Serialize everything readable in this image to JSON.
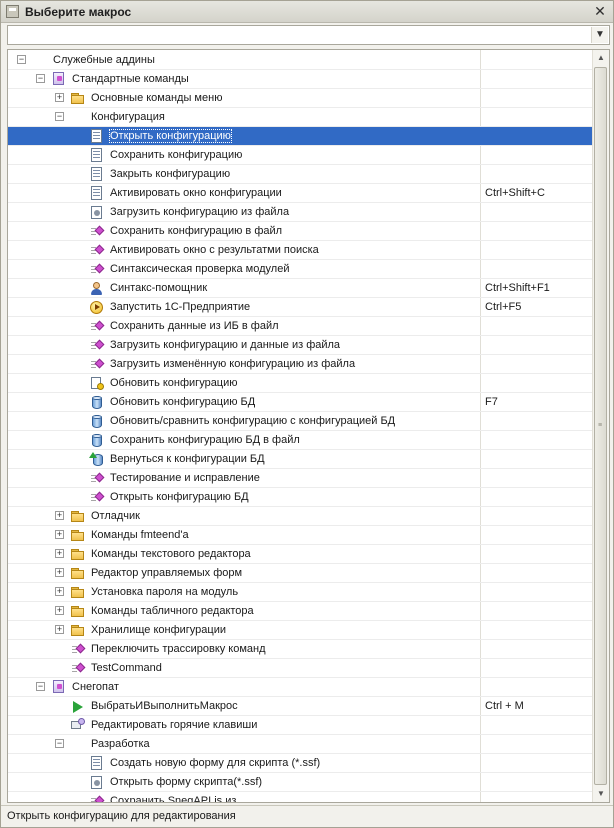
{
  "window": {
    "title": "Выберите макрос",
    "close_label": "✕"
  },
  "filter": {
    "value": "",
    "arrow": "▼"
  },
  "tree": {
    "rows": [
      {
        "level": 0,
        "expander": "−",
        "icon": "folder-open",
        "label": "Служебные аддины",
        "hotkey": ""
      },
      {
        "level": 1,
        "expander": "−",
        "icon": "purple",
        "label": "Стандартные команды",
        "hotkey": ""
      },
      {
        "level": 2,
        "expander": "+",
        "icon": "folder",
        "label": "Основные команды меню",
        "hotkey": ""
      },
      {
        "level": 2,
        "expander": "−",
        "icon": "folder-open",
        "label": "Конфигурация",
        "hotkey": ""
      },
      {
        "level": 3,
        "expander": "",
        "icon": "doc",
        "label": "Открыть конфигурацию",
        "hotkey": "",
        "selected": true
      },
      {
        "level": 3,
        "expander": "",
        "icon": "doc",
        "label": "Сохранить конфигурацию",
        "hotkey": ""
      },
      {
        "level": 3,
        "expander": "",
        "icon": "doc",
        "label": "Закрыть конфигурацию",
        "hotkey": ""
      },
      {
        "level": 3,
        "expander": "",
        "icon": "doc",
        "label": "Активировать окно конфигурации",
        "hotkey": "Ctrl+Shift+C"
      },
      {
        "level": 3,
        "expander": "",
        "icon": "gear",
        "label": "Загрузить конфигурацию из файла",
        "hotkey": ""
      },
      {
        "level": 3,
        "expander": "",
        "icon": "diamond",
        "label": "Сохранить конфигурацию в файл",
        "hotkey": ""
      },
      {
        "level": 3,
        "expander": "",
        "icon": "diamond",
        "label": "Активировать окно с результатми поиска",
        "hotkey": ""
      },
      {
        "level": 3,
        "expander": "",
        "icon": "diamond",
        "label": "Синтаксическая проверка модулей",
        "hotkey": ""
      },
      {
        "level": 3,
        "expander": "",
        "icon": "person",
        "label": "Синтакс-помощник",
        "hotkey": "Ctrl+Shift+F1"
      },
      {
        "level": 3,
        "expander": "",
        "icon": "play",
        "label": "Запустить 1С-Предприятие",
        "hotkey": "Ctrl+F5"
      },
      {
        "level": 3,
        "expander": "",
        "icon": "diamond",
        "label": "Сохранить данные из ИБ в файл",
        "hotkey": ""
      },
      {
        "level": 3,
        "expander": "",
        "icon": "diamond",
        "label": "Загрузить конфигурацию и данные из файла",
        "hotkey": ""
      },
      {
        "level": 3,
        "expander": "",
        "icon": "diamond",
        "label": "Загрузить изменённую конфигурацию из файла",
        "hotkey": ""
      },
      {
        "level": 3,
        "expander": "",
        "icon": "refresh",
        "label": "Обновить конфигурацию",
        "hotkey": ""
      },
      {
        "level": 3,
        "expander": "",
        "icon": "db",
        "label": "Обновить конфигурацию БД",
        "hotkey": "F7"
      },
      {
        "level": 3,
        "expander": "",
        "icon": "db",
        "label": "Обновить/сравнить конфигурацию с конфигурацией БД",
        "hotkey": ""
      },
      {
        "level": 3,
        "expander": "",
        "icon": "db",
        "label": "Сохранить конфигурацию БД в файл",
        "hotkey": ""
      },
      {
        "level": 3,
        "expander": "",
        "icon": "return",
        "label": "Вернуться  к конфигурации БД",
        "hotkey": ""
      },
      {
        "level": 3,
        "expander": "",
        "icon": "diamond",
        "label": "Тестирование и исправление",
        "hotkey": ""
      },
      {
        "level": 3,
        "expander": "",
        "icon": "diamond",
        "label": "Открыть конфигурацию БД",
        "hotkey": ""
      },
      {
        "level": 2,
        "expander": "+",
        "icon": "folder",
        "label": "Отладчик",
        "hotkey": ""
      },
      {
        "level": 2,
        "expander": "+",
        "icon": "folder",
        "label": "Команды fmteend'a",
        "hotkey": ""
      },
      {
        "level": 2,
        "expander": "+",
        "icon": "folder",
        "label": "Команды текстового редактора",
        "hotkey": ""
      },
      {
        "level": 2,
        "expander": "+",
        "icon": "folder",
        "label": "Редактор управляемых форм",
        "hotkey": ""
      },
      {
        "level": 2,
        "expander": "+",
        "icon": "folder",
        "label": "Установка пароля на модуль",
        "hotkey": ""
      },
      {
        "level": 2,
        "expander": "+",
        "icon": "folder",
        "label": "Команды табличного редактора",
        "hotkey": ""
      },
      {
        "level": 2,
        "expander": "+",
        "icon": "folder",
        "label": "Хранилище конфигурации",
        "hotkey": ""
      },
      {
        "level": 2,
        "expander": "",
        "icon": "diamond",
        "label": "Переключить трассировку команд",
        "hotkey": ""
      },
      {
        "level": 2,
        "expander": "",
        "icon": "diamond",
        "label": "TestCommand",
        "hotkey": ""
      },
      {
        "level": 1,
        "expander": "−",
        "icon": "purple",
        "label": "Снегопат",
        "hotkey": ""
      },
      {
        "level": 2,
        "expander": "",
        "icon": "arrow-green",
        "label": "ВыбратьИВыполнитьМакрос",
        "hotkey": "Ctrl + M"
      },
      {
        "level": 2,
        "expander": "",
        "icon": "keys",
        "label": "Редактировать горячие клавиши",
        "hotkey": ""
      },
      {
        "level": 2,
        "expander": "−",
        "icon": "folder-open",
        "label": "Разработка",
        "hotkey": ""
      },
      {
        "level": 3,
        "expander": "",
        "icon": "doc",
        "label": "Создать новую форму для скрипта (*.ssf)",
        "hotkey": ""
      },
      {
        "level": 3,
        "expander": "",
        "icon": "gear",
        "label": "Открыть форму скрипта(*.ssf)",
        "hotkey": ""
      },
      {
        "level": 3,
        "expander": "",
        "icon": "diamond",
        "label": "Сохранить SnegAPI.js из ...",
        "hotkey": ""
      }
    ]
  },
  "scrollbar": {
    "up": "▲",
    "down": "▼",
    "grip": "≡"
  },
  "status": {
    "text": "Открыть конфигурацию для редактирования"
  }
}
